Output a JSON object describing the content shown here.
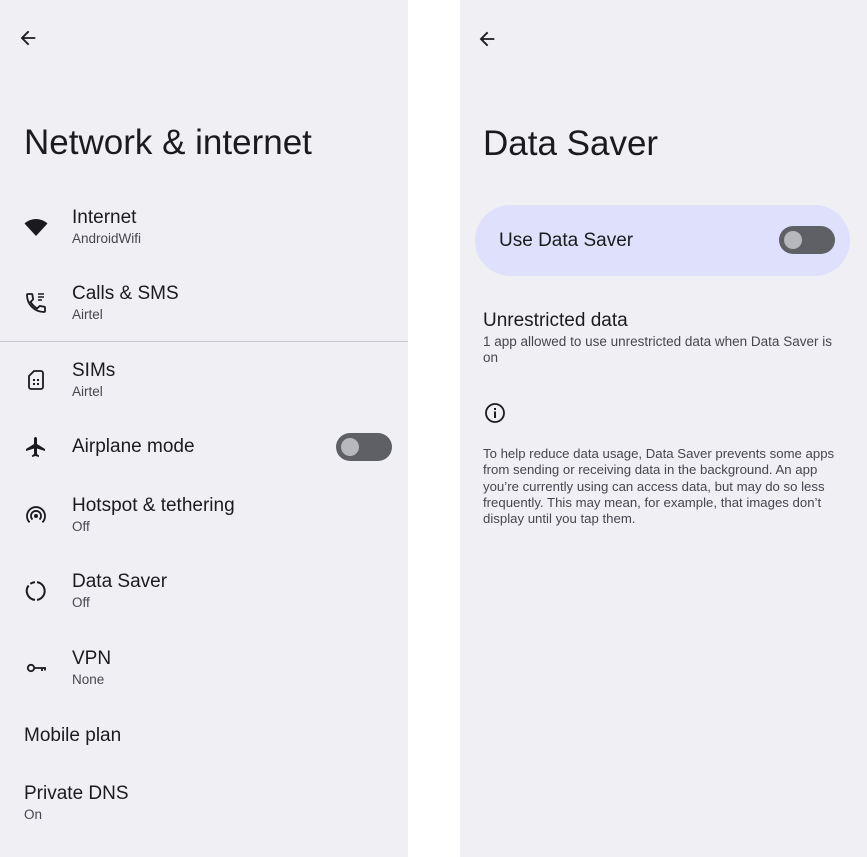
{
  "left_screen": {
    "title": "Network & internet",
    "items": [
      {
        "name": "Internet",
        "subtitle": "AndroidWifi",
        "icon": "wifi-icon"
      },
      {
        "name": "Calls & SMS",
        "subtitle": "Airtel",
        "icon": "phone-icon"
      },
      {
        "name": "SIMs",
        "subtitle": "Airtel",
        "icon": "sim-card-icon"
      },
      {
        "name": "Airplane mode",
        "subtitle": "",
        "icon": "airplane-icon",
        "toggle": "off"
      },
      {
        "name": "Hotspot & tethering",
        "subtitle": "Off",
        "icon": "hotspot-icon"
      },
      {
        "name": "Data Saver",
        "subtitle": "Off",
        "icon": "data-saver-icon"
      },
      {
        "name": "VPN",
        "subtitle": "None",
        "icon": "vpn-key-icon"
      },
      {
        "name": "Mobile plan",
        "subtitle": ""
      },
      {
        "name": "Private DNS",
        "subtitle": "On"
      }
    ]
  },
  "right_screen": {
    "title": "Data Saver",
    "use_data_saver_label": "Use Data Saver",
    "use_data_saver_state": "off",
    "unrestricted_title": "Unrestricted data",
    "unrestricted_subtitle": "1 app allowed to use unrestricted data when Data Saver is on",
    "info_text": "To help reduce data usage, Data Saver prevents some apps from sending or receiving data in the background. An app you’re currently using can access data, but may do so less frequently. This may mean, for example, that images don’t display until you tap them."
  },
  "colors": {
    "panel_background": "#f0eff4",
    "card_background": "#dfe0fb",
    "switch_track": "#5e6065",
    "divider": "#c8c7cf"
  }
}
